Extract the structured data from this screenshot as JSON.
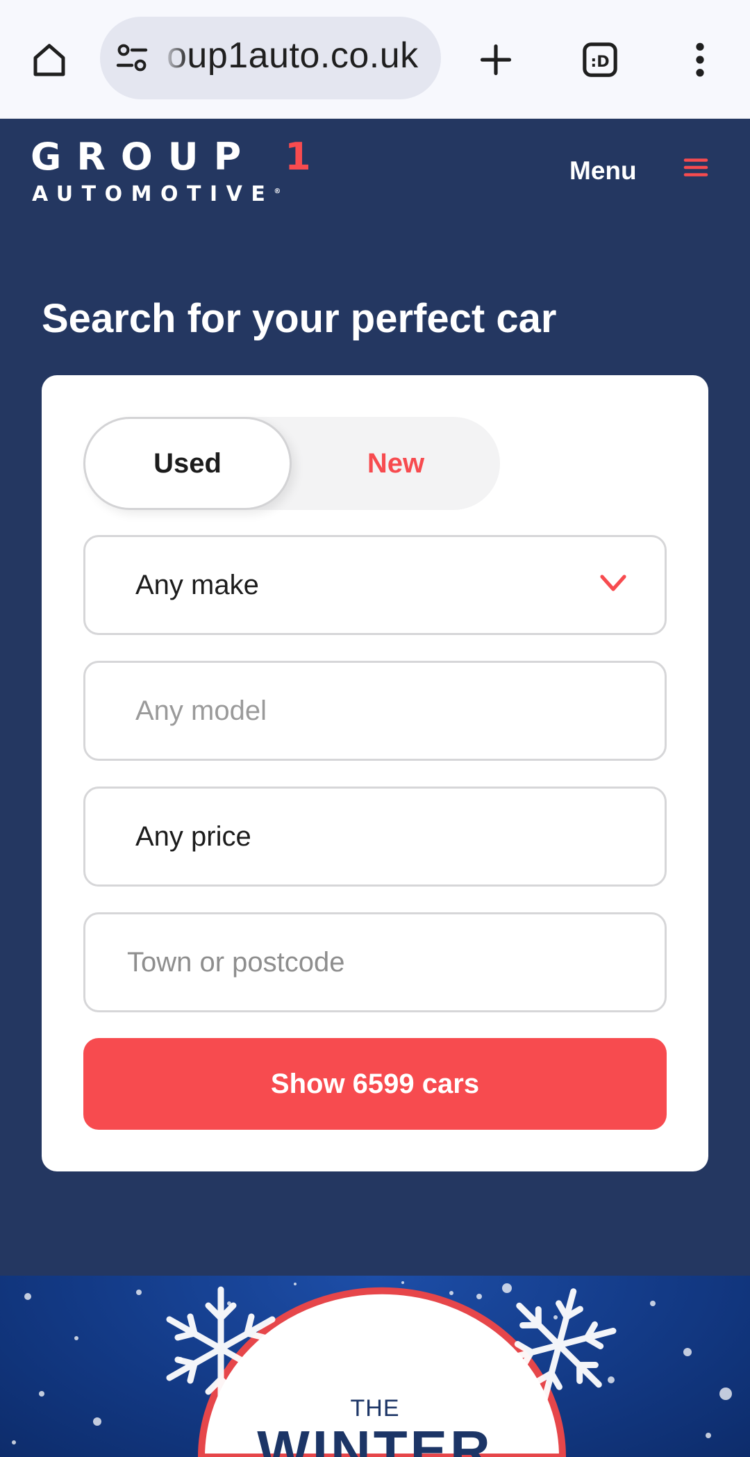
{
  "browser": {
    "url": "oup1auto.co.uk",
    "icons": [
      "home-icon",
      "site-settings-icon",
      "new-tab-icon",
      "tab-switcher-icon",
      "more-vert-icon"
    ]
  },
  "header": {
    "logo_line1": "GROUP",
    "logo_number": "1",
    "logo_line2": "AUTOMOTIVE",
    "logo_reg": "®",
    "menu_label": "Menu",
    "accent_color": "#f74b4f",
    "background_color": "#243761"
  },
  "search": {
    "title": "Search for your perfect car",
    "toggle": {
      "used_label": "Used",
      "new_label": "New",
      "selected": "Used"
    },
    "make": {
      "value": "Any make"
    },
    "model": {
      "placeholder": "Any model"
    },
    "price": {
      "value": "Any price"
    },
    "location": {
      "placeholder": "Town or postcode"
    },
    "submit_label": "Show 6599 cars"
  },
  "banner": {
    "line1": "THE",
    "line2": "WINTER"
  }
}
